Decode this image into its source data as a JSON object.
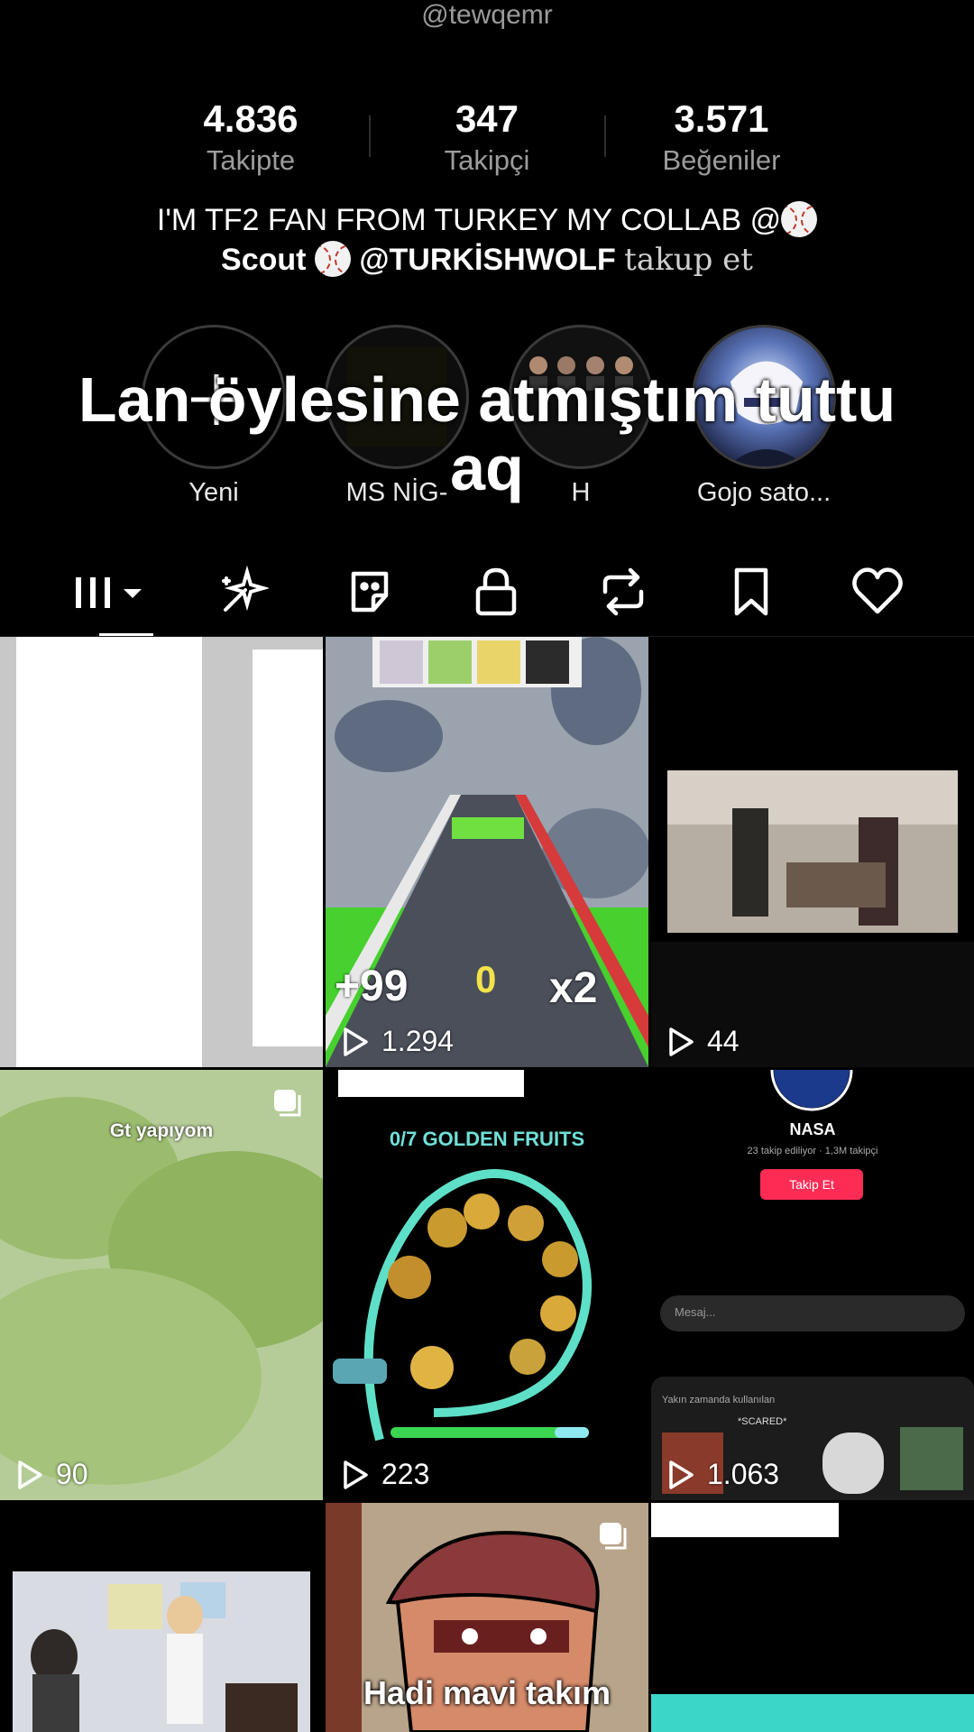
{
  "profile": {
    "handle": "@tewqemr",
    "stats": [
      {
        "value": "4.836",
        "label": "Takipte"
      },
      {
        "value": "347",
        "label": "Takipçi"
      },
      {
        "value": "3.571",
        "label": "Beğeniler"
      }
    ],
    "bio_line1": "I'M TF2 FAN FROM TURKEY MY COLLAB @",
    "bio_line2_a": "Scout",
    "bio_line2_b": "@TURKİSHWOLF",
    "bio_line2_c": "takup et"
  },
  "highlights": [
    {
      "label": "Yeni"
    },
    {
      "label": "MS NİG-"
    },
    {
      "label": "H"
    },
    {
      "label": "Gojo sato..."
    }
  ],
  "overlay_caption": {
    "line1": "Lan öylesine atmıştım tuttu",
    "line2": "aq"
  },
  "tabs": [
    "grid",
    "reposts-sparkle",
    "stickers",
    "private",
    "repost",
    "bookmark",
    "liked"
  ],
  "videos": [
    {
      "views": ""
    },
    {
      "views": "1.294",
      "overlay_score": "+99",
      "overlay_zero": "0",
      "overlay_mult": "x2"
    },
    {
      "views": "44"
    },
    {
      "views": "90",
      "caption": "Gt yapıyom"
    },
    {
      "views": "223",
      "caption": "0/7 GOLDEN FRUITS"
    },
    {
      "views": "1.063",
      "nasa_title": "NASA",
      "nasa_sub": "23 takip ediliyor · 1,3M takipçi",
      "nasa_btn": "Takip Et",
      "msg_placeholder": "Mesaj...",
      "recent_label": "Yakın zamanda kullanılan",
      "sticker_label": "*SCARED*"
    },
    {
      "views": ""
    },
    {
      "views": "",
      "caption": "Hadi mavi takım"
    },
    {
      "views": ""
    }
  ],
  "colors": {
    "bg": "#000000",
    "muted": "#9c9c9c",
    "accent": "#fe2c55",
    "game_green": "#5fe04a"
  }
}
